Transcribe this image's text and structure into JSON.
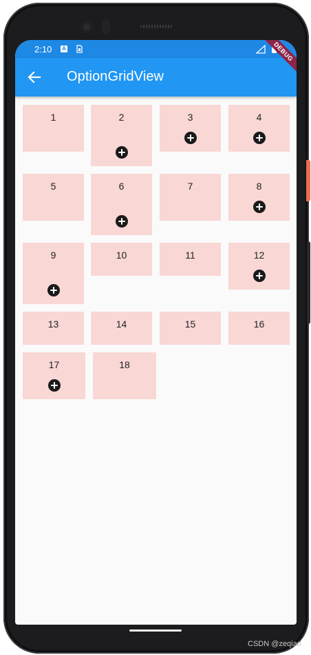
{
  "status_bar": {
    "time": "2:10",
    "notification_icon_label": "A",
    "icons": [
      "text-notification-icon",
      "sim-card-icon",
      "signal-icon",
      "battery-icon"
    ]
  },
  "debug_banner": "DEBUG",
  "app_bar": {
    "title": "OptionGridView",
    "back_icon": "arrow-back-icon"
  },
  "grid": {
    "item_color": "#f8d7d5",
    "items": [
      {
        "label": "1",
        "has_add_icon": false
      },
      {
        "label": "2",
        "has_add_icon": true
      },
      {
        "label": "3",
        "has_add_icon": true
      },
      {
        "label": "4",
        "has_add_icon": true
      },
      {
        "label": "5",
        "has_add_icon": false
      },
      {
        "label": "6",
        "has_add_icon": true
      },
      {
        "label": "7",
        "has_add_icon": false
      },
      {
        "label": "8",
        "has_add_icon": true
      },
      {
        "label": "9",
        "has_add_icon": true
      },
      {
        "label": "10",
        "has_add_icon": false
      },
      {
        "label": "11",
        "has_add_icon": false
      },
      {
        "label": "12",
        "has_add_icon": true
      },
      {
        "label": "13",
        "has_add_icon": false
      },
      {
        "label": "14",
        "has_add_icon": false
      },
      {
        "label": "15",
        "has_add_icon": false
      },
      {
        "label": "16",
        "has_add_icon": false
      },
      {
        "label": "17",
        "has_add_icon": true
      },
      {
        "label": "18",
        "has_add_icon": false
      }
    ]
  },
  "colors": {
    "app_bar": "#2196f3",
    "status_bar": "#1e88e5",
    "background": "#fafafa"
  },
  "watermark": "CSDN @zeqiao"
}
